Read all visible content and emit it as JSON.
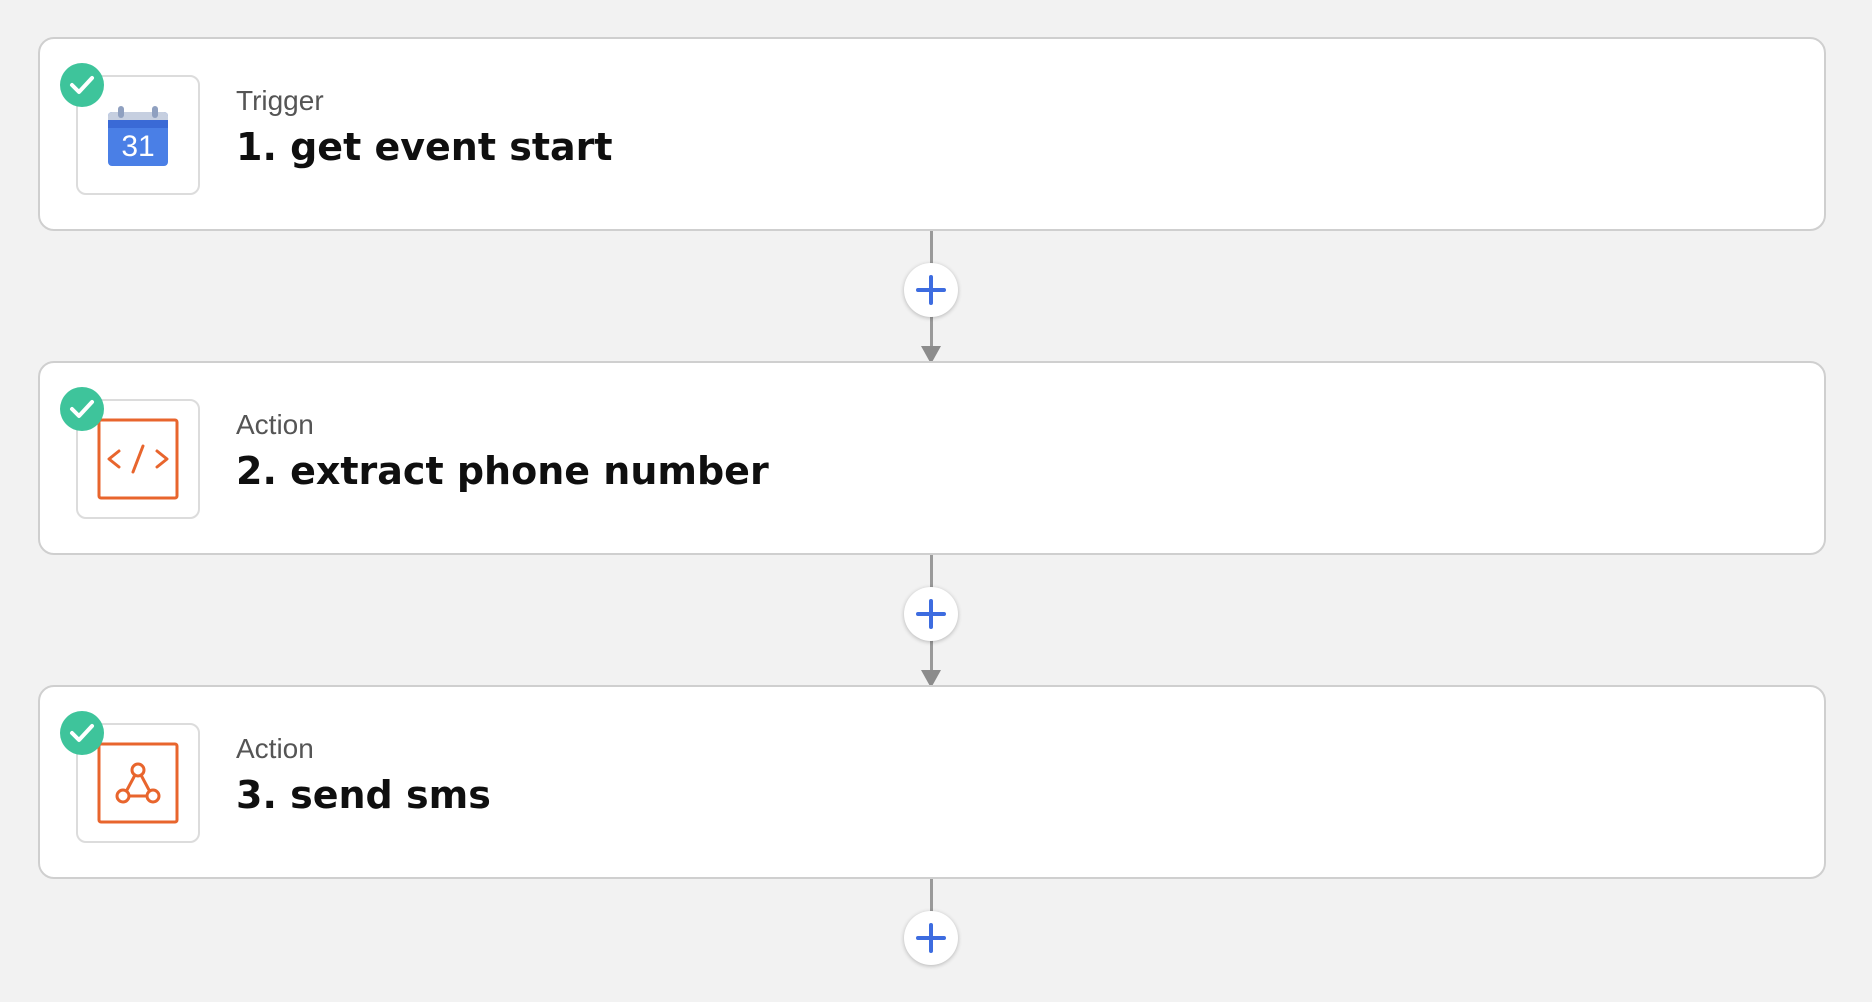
{
  "steps": [
    {
      "type": "Trigger",
      "title": "1. get event start",
      "app_icon": "google-calendar-icon",
      "calendar_day": "31",
      "status": "complete"
    },
    {
      "type": "Action",
      "title": "2. extract phone number",
      "app_icon": "code-icon",
      "status": "complete"
    },
    {
      "type": "Action",
      "title": "3. send sms",
      "app_icon": "webhook-icon",
      "status": "complete"
    }
  ],
  "colors": {
    "background": "#f2f2f2",
    "check_badge": "#3ec49b",
    "add_button_plus": "#3d6ce0",
    "app_icon_orange": "#e8652d",
    "calendar_blue": "#4a7fe6"
  },
  "add_step_buttons": [
    {
      "icon": "plus-icon"
    },
    {
      "icon": "plus-icon"
    },
    {
      "icon": "plus-icon"
    }
  ]
}
